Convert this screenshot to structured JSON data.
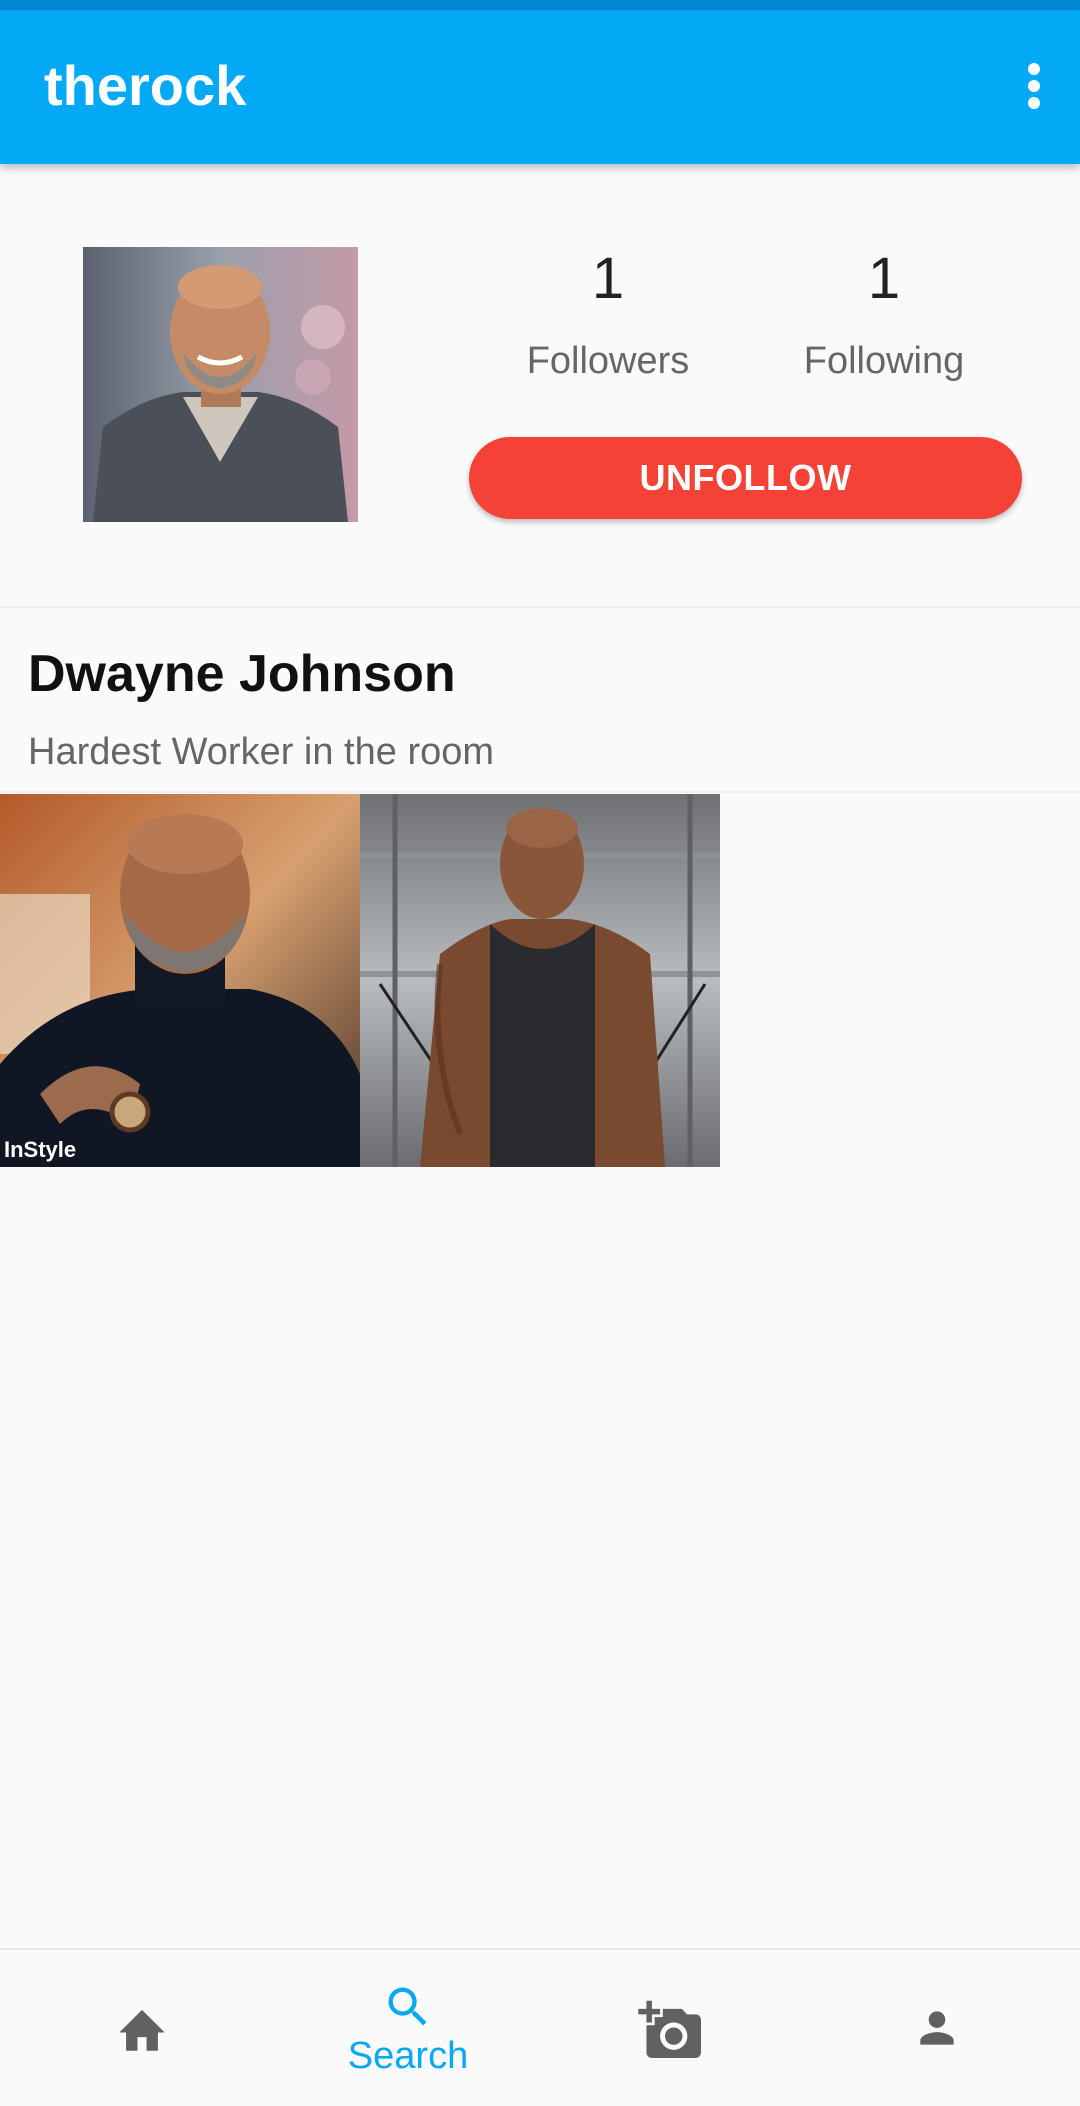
{
  "app_bar": {
    "title": "therock",
    "menu_icon": "more-vert-icon"
  },
  "profile": {
    "photo_icon": "profile-photo",
    "followers": {
      "count": "1",
      "label": "Followers"
    },
    "following": {
      "count": "1",
      "label": "Following"
    },
    "unfollow_label": "UNFOLLOW",
    "name": "Dwayne Johnson",
    "bio": "Hardest Worker in the room"
  },
  "posts": [
    {
      "icon": "post-photo-portrait",
      "watermark": "InStyle"
    },
    {
      "icon": "post-photo-gym"
    }
  ],
  "bottom_nav": {
    "items": [
      {
        "icon": "home-icon",
        "label": ""
      },
      {
        "icon": "search-icon",
        "label": "Search"
      },
      {
        "icon": "add-photo-icon",
        "label": ""
      },
      {
        "icon": "person-icon",
        "label": ""
      }
    ],
    "active_color": "#03a9f4",
    "inactive_color": "#616161"
  },
  "colors": {
    "primary": "#03a9f4",
    "primary_dark": "#0288d1",
    "unfollow": "#f44336"
  }
}
